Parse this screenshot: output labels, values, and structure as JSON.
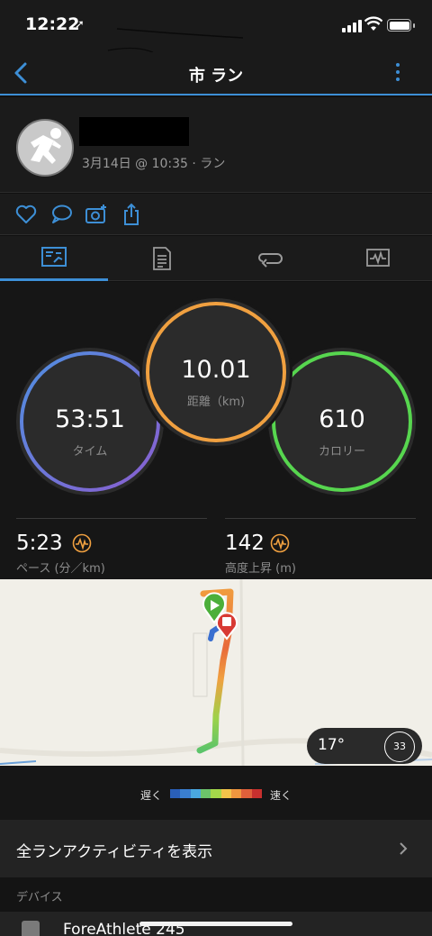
{
  "status_bar": {
    "time": "12:22",
    "location_arrow": "➚"
  },
  "nav": {
    "title": "市 ラン",
    "back_icon": "chevron-left",
    "more_icon": "vertical-ellipsis",
    "accent_color": "#3d8fd6"
  },
  "activity": {
    "meta": "3月14日 @ 10:35 · ラン"
  },
  "actions": [
    "heart",
    "comment",
    "add-photo",
    "share"
  ],
  "tabs": [
    {
      "icon": "overview",
      "selected": true
    },
    {
      "icon": "details",
      "selected": false
    },
    {
      "icon": "laps",
      "selected": false
    },
    {
      "icon": "charts",
      "selected": false
    }
  ],
  "stats": {
    "time": {
      "value": "53:51",
      "label": "タイム"
    },
    "distance": {
      "value": "10.01",
      "label": "距離（km)"
    },
    "calories": {
      "value": "610",
      "label": "カロリー"
    }
  },
  "summary": {
    "pace": {
      "value": "5:23",
      "label": "ペース (分／km)"
    },
    "elevation": {
      "value": "142",
      "label": "高度上昇 (m)"
    }
  },
  "weather": {
    "temperature": "17°",
    "wind": "33"
  },
  "legend": {
    "slow": "遅く",
    "fast": "速く",
    "colors": [
      "#2a5fb8",
      "#3a7fd0",
      "#4aa8e0",
      "#6cc36a",
      "#a5d84a",
      "#f3c44a",
      "#f0963e",
      "#e0603a",
      "#c8302e"
    ]
  },
  "all_runs": {
    "label": "全ランアクティビティを表示"
  },
  "devices": {
    "section_title": "デバイス",
    "device_name": "ForeAthlete 245"
  }
}
